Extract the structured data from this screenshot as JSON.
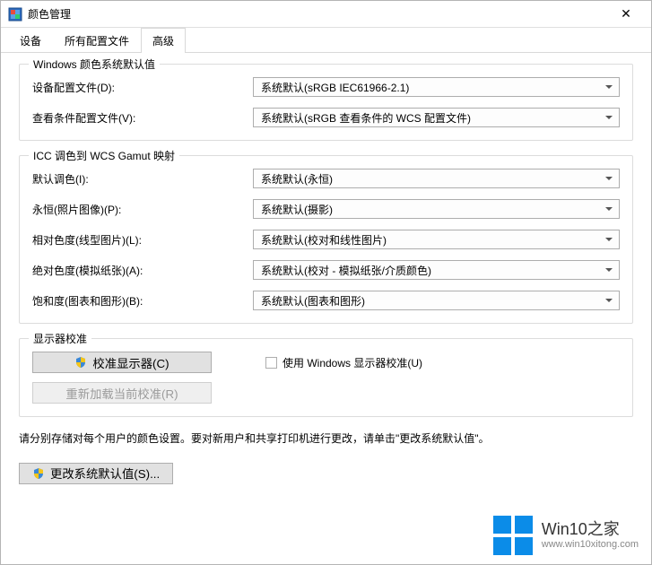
{
  "window": {
    "title": "颜色管理",
    "close_label": "✕"
  },
  "tabs": {
    "items": [
      {
        "label": "设备"
      },
      {
        "label": "所有配置文件"
      },
      {
        "label": "高级"
      }
    ],
    "active_index": 2
  },
  "group_defaults": {
    "legend": "Windows 颜色系统默认值",
    "rows": [
      {
        "label": "设备配置文件(D):",
        "value": "系统默认(sRGB IEC61966-2.1)"
      },
      {
        "label": "查看条件配置文件(V):",
        "value": "系统默认(sRGB 查看条件的 WCS 配置文件)"
      }
    ]
  },
  "group_icc": {
    "legend": "ICC 调色到 WCS Gamut 映射",
    "rows": [
      {
        "label": "默认调色(I):",
        "value": "系统默认(永恒)"
      },
      {
        "label": "永恒(照片图像)(P):",
        "value": "系统默认(摄影)"
      },
      {
        "label": "相对色度(线型图片)(L):",
        "value": "系统默认(校对和线性图片)"
      },
      {
        "label": "绝对色度(模拟纸张)(A):",
        "value": "系统默认(校对 - 模拟纸张/介质颜色)"
      },
      {
        "label": "饱和度(图表和图形)(B):",
        "value": "系统默认(图表和图形)"
      }
    ]
  },
  "group_calib": {
    "legend": "显示器校准",
    "calibrate_button": "校准显示器(C)",
    "use_checkbox_label": "使用 Windows 显示器校准(U)",
    "reload_button": "重新加载当前校准(R)"
  },
  "hint": "请分别存储对每个用户的颜色设置。要对新用户和共享打印机进行更改，请单击\"更改系统默认值\"。",
  "footer": {
    "change_defaults_button": "更改系统默认值(S)..."
  },
  "watermark": {
    "main": "Win10之家",
    "sub": "www.win10xitong.com"
  }
}
